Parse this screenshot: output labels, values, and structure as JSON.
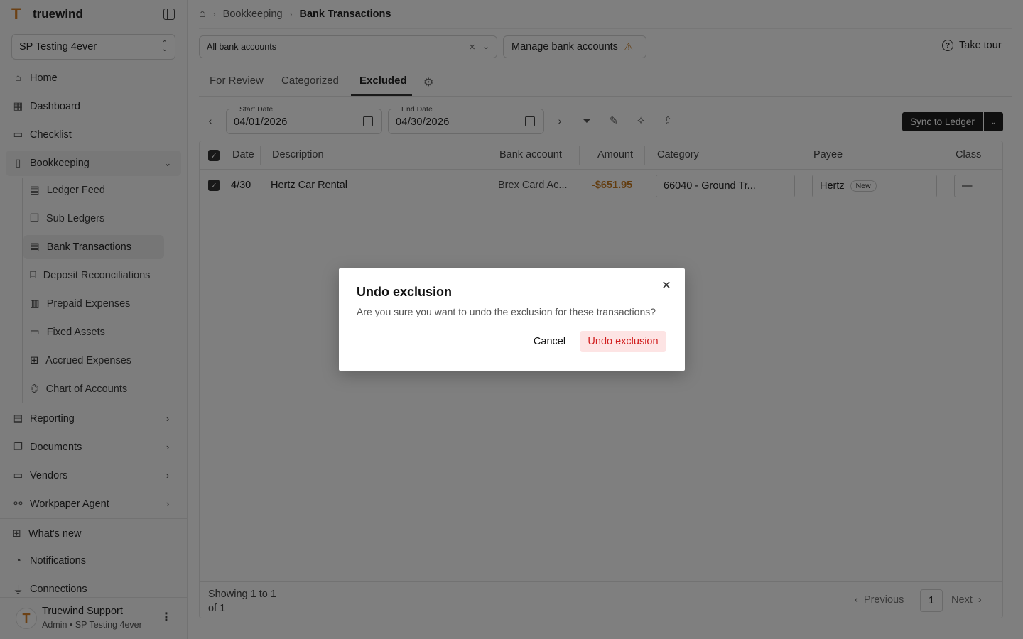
{
  "brand": {
    "name": "truewind",
    "logo_letter": "T"
  },
  "org_selector": {
    "value": "SP Testing 4ever"
  },
  "sidebar": {
    "items": [
      {
        "label": "Home",
        "icon": "home-icon"
      },
      {
        "label": "Dashboard",
        "icon": "dashboard-icon"
      },
      {
        "label": "Checklist",
        "icon": "calendar-icon"
      },
      {
        "label": "Bookkeeping",
        "icon": "book-icon"
      }
    ],
    "bookkeeping_children": [
      {
        "label": "Ledger Feed",
        "icon": "ledger-icon"
      },
      {
        "label": "Sub Ledgers",
        "icon": "copy-icon"
      },
      {
        "label": "Bank Transactions",
        "icon": "receipt-icon"
      },
      {
        "label": "Deposit Reconciliations",
        "icon": "scan-icon"
      },
      {
        "label": "Prepaid Expenses",
        "icon": "clipboard-icon"
      },
      {
        "label": "Fixed Assets",
        "icon": "laptop-icon"
      },
      {
        "label": "Accrued Expenses",
        "icon": "plus-doc-icon"
      },
      {
        "label": "Chart of Accounts",
        "icon": "hierarchy-icon"
      }
    ],
    "collapsed_sections": [
      {
        "label": "Reporting",
        "icon": "report-icon"
      },
      {
        "label": "Documents",
        "icon": "documents-icon"
      },
      {
        "label": "Vendors",
        "icon": "vendor-icon"
      },
      {
        "label": "Workpaper Agent",
        "icon": "agent-icon"
      }
    ],
    "footer_links": [
      {
        "label": "What's new",
        "icon": "gift-icon"
      },
      {
        "label": "Notifications",
        "icon": "bell-icon"
      },
      {
        "label": "Connections",
        "icon": "plug-icon"
      }
    ]
  },
  "user": {
    "name": "Truewind Support",
    "role": "Admin • SP Testing 4ever",
    "avatar_letter": "T"
  },
  "breadcrumb": {
    "level1": "Bookkeeping",
    "current": "Bank Transactions"
  },
  "accounts_filter": {
    "value": "All bank accounts"
  },
  "manage_accounts_label": "Manage bank accounts",
  "take_tour_label": "Take tour",
  "tabs": [
    "For Review",
    "Categorized",
    "Excluded"
  ],
  "active_tab": "Excluded",
  "dates": {
    "start_label": "Start Date",
    "start_value": "04/01/2026",
    "end_label": "End Date",
    "end_value": "04/30/2026"
  },
  "sync_label": "Sync to Ledger",
  "table": {
    "columns": [
      "Date",
      "Description",
      "Bank account",
      "Amount",
      "Category",
      "Payee",
      "Class"
    ],
    "rows": [
      {
        "date": "4/30",
        "description": "Hertz Car Rental",
        "bank_account": "Brex Card Ac...",
        "amount": "-$651.95",
        "category": "66040 - Ground Tr...",
        "payee": "Hertz",
        "payee_badge": "New",
        "class": "—"
      }
    ],
    "showing_text": "Showing 1 to 1 of 1",
    "pagination": {
      "previous": "Previous",
      "page": "1",
      "next": "Next"
    }
  },
  "dialog": {
    "title": "Undo exclusion",
    "message": "Are you sure you want to undo the exclusion for these transactions?",
    "cancel_label": "Cancel",
    "confirm_label": "Undo exclusion"
  },
  "colors": {
    "accent": "#d9822b",
    "danger": "#d11f1f",
    "danger_bg": "#fde4e4",
    "amount": "#c77a20"
  }
}
